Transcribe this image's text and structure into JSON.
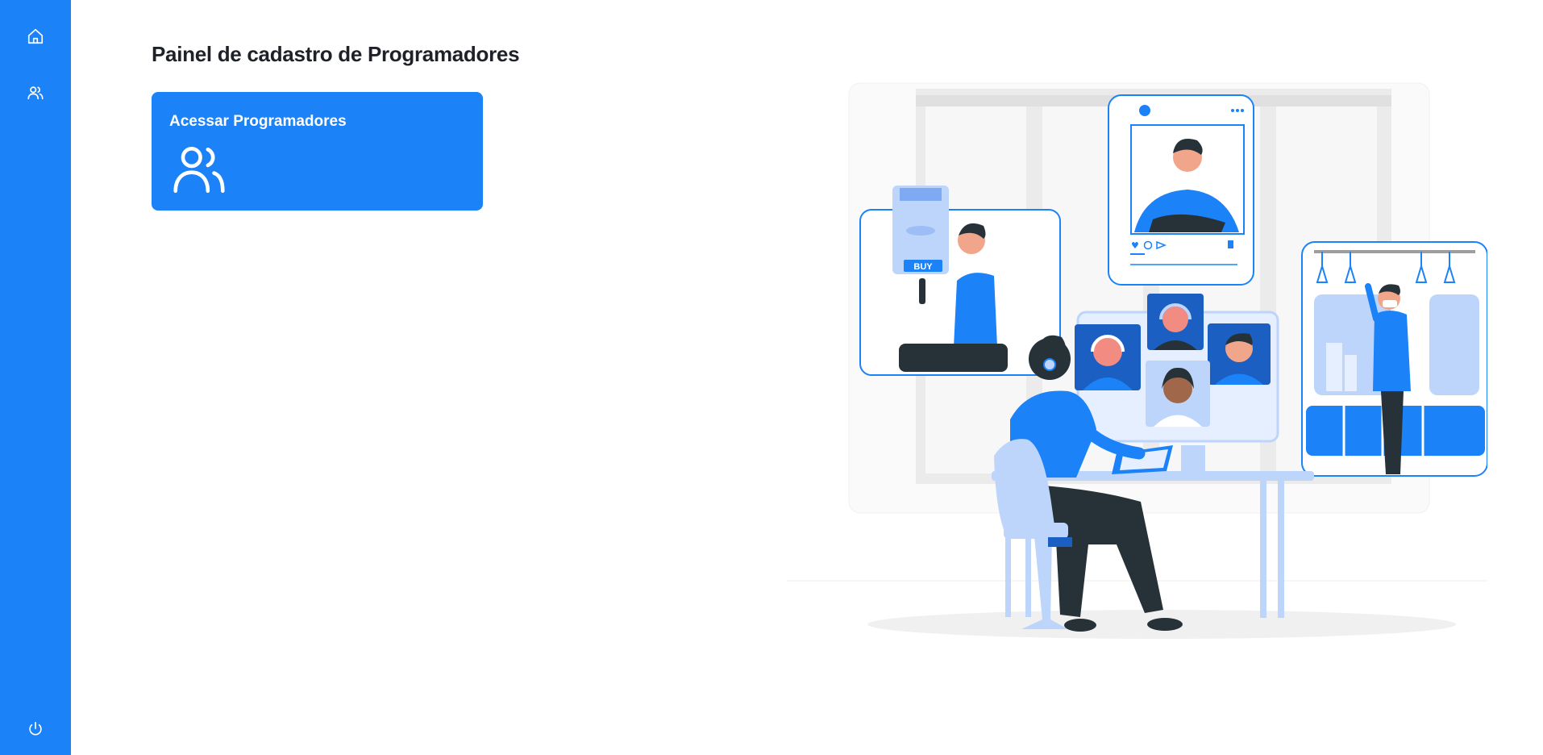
{
  "sidebar": {
    "items": [
      {
        "name": "home",
        "icon": "home-icon"
      },
      {
        "name": "programmers",
        "icon": "users-icon"
      }
    ],
    "logout_icon": "power-icon",
    "color": "#1b82f7"
  },
  "page": {
    "title": "Painel de cadastro de Programadores"
  },
  "card": {
    "label": "Acessar Programadores",
    "icon": "users-icon",
    "color": "#1b82f7"
  },
  "illustration": {
    "subject": "video-call-illustration",
    "buy_label": "BUY"
  },
  "colors": {
    "accent": "#1b82f7",
    "light_blue": "#bdd4fb",
    "dark": "#263238"
  }
}
